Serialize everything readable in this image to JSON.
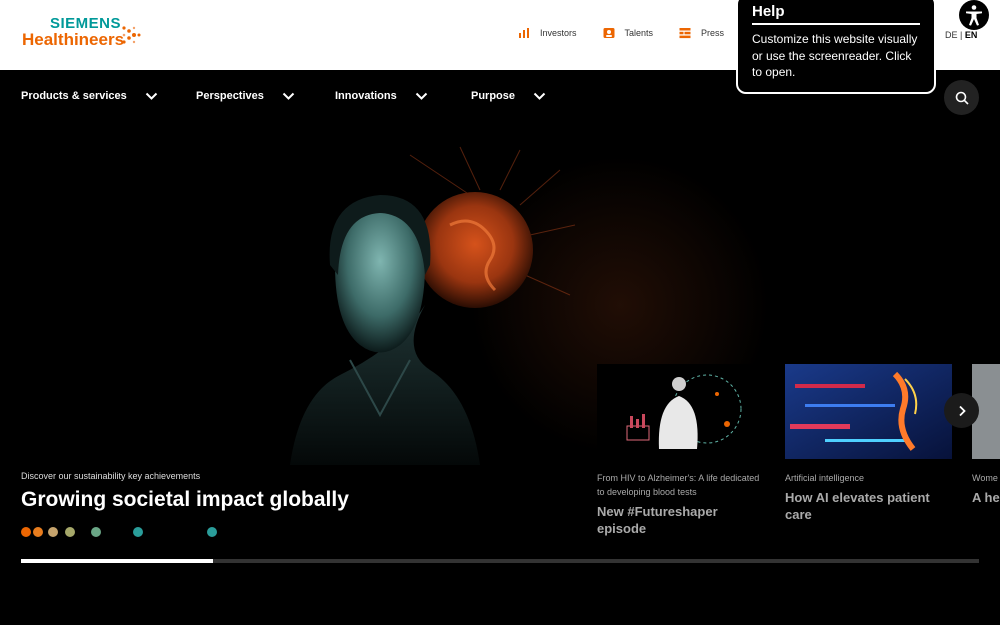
{
  "brand": {
    "line1": "SIEMENS",
    "line2": "Healthineers"
  },
  "toplinks": [
    {
      "label": "Investors",
      "icon": "chart-icon"
    },
    {
      "label": "Talents",
      "icon": "person-icon"
    },
    {
      "label": "Press",
      "icon": "press-icon"
    }
  ],
  "lang": {
    "de": "DE",
    "sep": " | ",
    "en": "EN"
  },
  "help": {
    "title": "Help",
    "text": "Customize this website visually or use the screenreader. Click to open."
  },
  "nav": {
    "items": [
      "Products & services",
      "Perspectives",
      "Innovations",
      "Purpose"
    ]
  },
  "hero": {
    "eyebrow": "Discover our sustainability key achievements",
    "headline": "Growing societal impact globally",
    "progress": 0.2,
    "dot_colors": [
      "#ec6602",
      "#e87d1e",
      "#c6a46d",
      "#a6a86a",
      "#6aa686",
      "#2a9d9a",
      "#2a9d9a"
    ]
  },
  "cards": [
    {
      "category": "From HIV to Alzheimer's: A life dedicated to developing blood tests",
      "title": "New #Futureshaper episode"
    },
    {
      "category": "Artificial intelligence",
      "title": "How AI elevates patient care"
    },
    {
      "category": "Wome",
      "title": "A he"
    }
  ],
  "colors": {
    "accent": "#ec6602",
    "teal": "#009999"
  }
}
